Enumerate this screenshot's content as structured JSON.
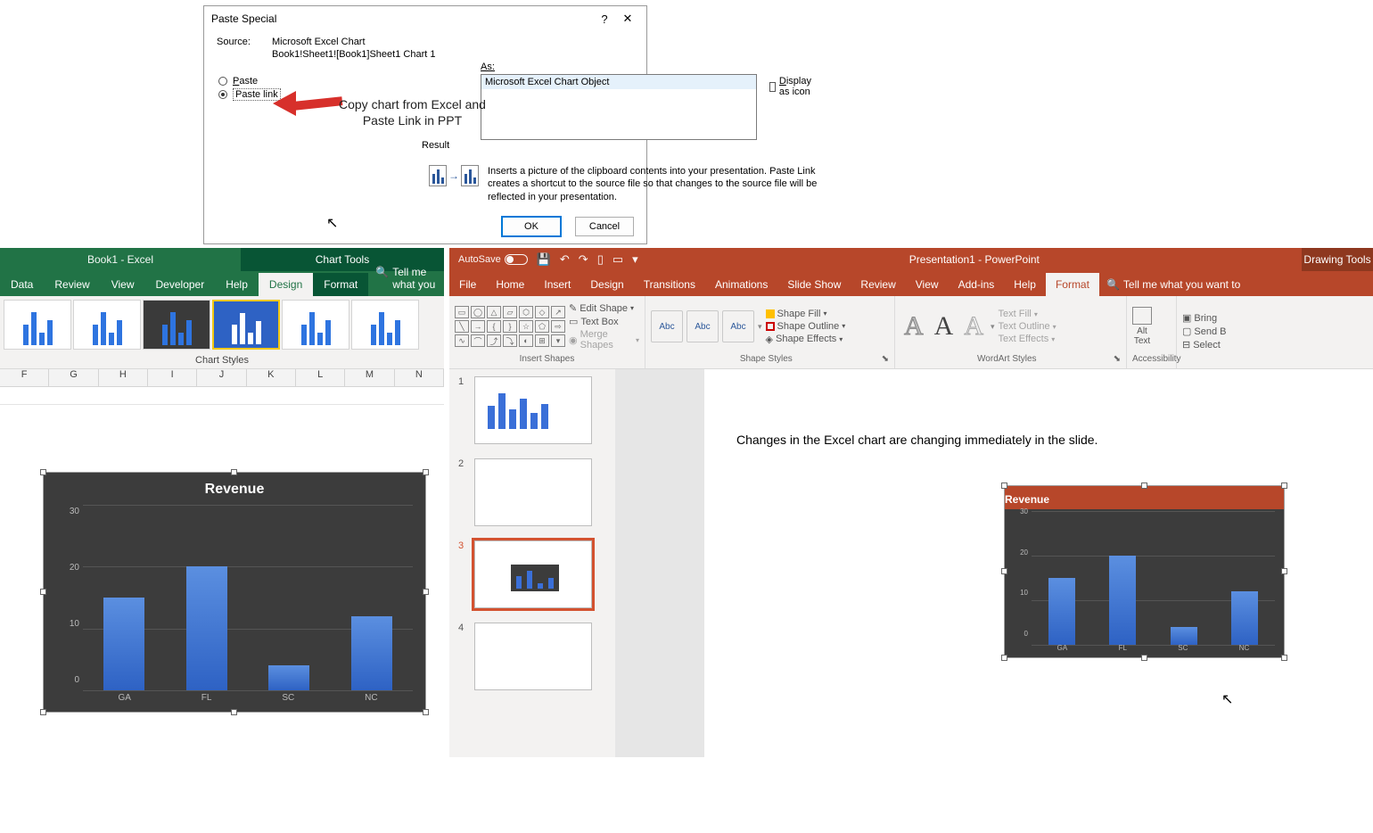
{
  "dialog": {
    "title": "Paste Special",
    "help": "?",
    "close": "✕",
    "source_label": "Source:",
    "source_value": "Microsoft Excel Chart",
    "source_path": "Book1!Sheet1![Book1]Sheet1 Chart 1",
    "as_label": "As:",
    "paste_label": "Paste",
    "paste_link_label": "Paste link",
    "as_option": "Microsoft Excel Chart Object",
    "display_as_icon": "Display as icon",
    "result_label": "Result",
    "result_text": "Inserts a picture of the clipboard contents into your presentation. Paste Link creates a shortcut to the source file so that changes to the source file will be reflected in your presentation.",
    "ok": "OK",
    "cancel": "Cancel",
    "annotation": "Copy chart from Excel and\nPaste Link in PPT"
  },
  "excel": {
    "title": "Book1  -  Excel",
    "tool_tab": "Chart Tools",
    "tabs": [
      "Data",
      "Review",
      "View",
      "Developer",
      "Help",
      "Design",
      "Format"
    ],
    "active_tab": "Design",
    "search": "Tell me what you",
    "styles_label": "Chart Styles",
    "columns": [
      "F",
      "G",
      "H",
      "I",
      "J",
      "K",
      "L",
      "M",
      "N"
    ]
  },
  "ppt": {
    "autosave": "AutoSave",
    "autosave_state": "Off",
    "title": "Presentation1  -  PowerPoint",
    "tool_tab": "Drawing Tools",
    "tabs": [
      "File",
      "Home",
      "Insert",
      "Design",
      "Transitions",
      "Animations",
      "Slide Show",
      "Review",
      "View",
      "Add-ins",
      "Help",
      "Format"
    ],
    "active_tab": "Format",
    "search": "Tell me what you want to",
    "ribbon": {
      "edit_shape": "Edit Shape",
      "text_box": "Text Box",
      "merge_shapes": "Merge Shapes",
      "insert_shapes": "Insert Shapes",
      "shape_fill": "Shape Fill",
      "shape_outline": "Shape Outline",
      "shape_effects": "Shape Effects",
      "shape_styles": "Shape Styles",
      "text_fill": "Text Fill",
      "text_outline": "Text Outline",
      "text_effects": "Text Effects",
      "wordart_styles": "WordArt Styles",
      "alt_text": "Alt\nText",
      "accessibility": "Accessibility",
      "bring": "Bring",
      "send": "Send B",
      "select": "Select",
      "abc": "Abc"
    },
    "slides": [
      "1",
      "2",
      "3",
      "4"
    ],
    "active_slide": 3,
    "annotation": "Changes in the Excel chart are changing immediately in the slide."
  },
  "chart_data": {
    "type": "bar",
    "title": "Revenue",
    "categories": [
      "GA",
      "FL",
      "SC",
      "NC"
    ],
    "values": [
      15,
      20,
      4,
      12
    ],
    "ylabel": "",
    "xlabel": "",
    "ylim": [
      0,
      30
    ],
    "yticks": [
      0,
      10,
      20,
      30
    ]
  }
}
